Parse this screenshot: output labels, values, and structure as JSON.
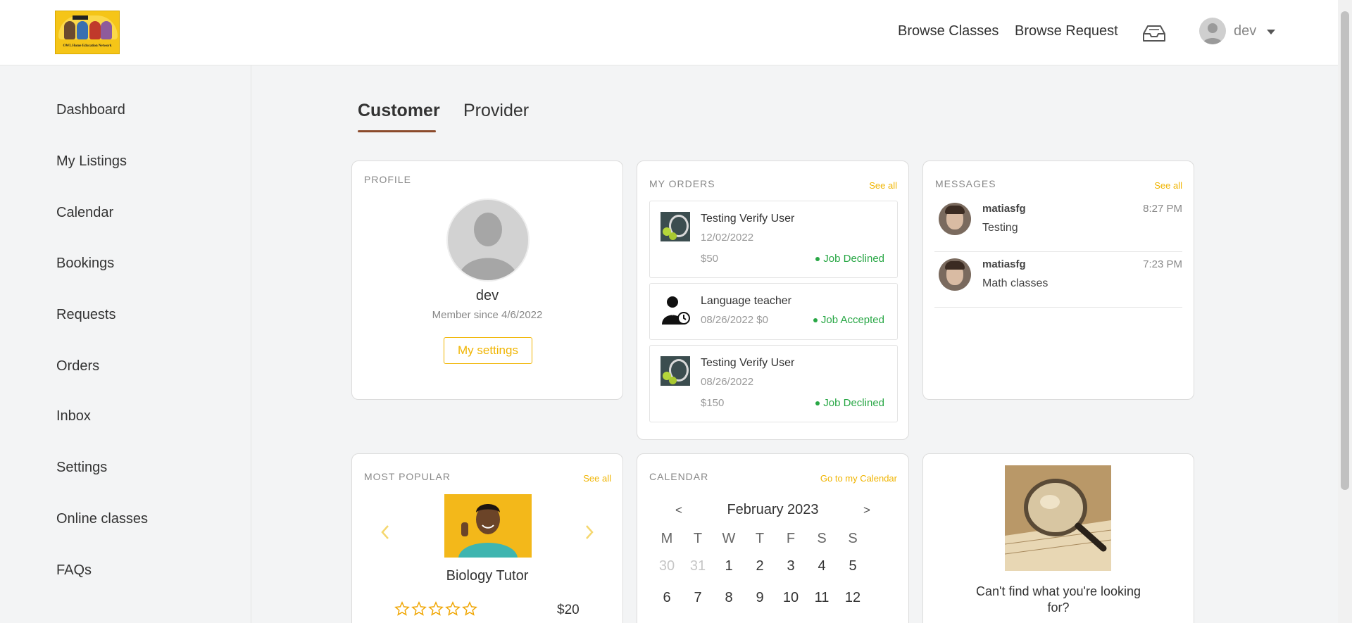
{
  "header": {
    "logo_text": "OWL Home Education Network",
    "nav": [
      "Browse Classes",
      "Browse Request"
    ],
    "user_name": "dev"
  },
  "sidebar": {
    "items": [
      "Dashboard",
      "My Listings",
      "Calendar",
      "Bookings",
      "Requests",
      "Orders",
      "Inbox",
      "Settings",
      "Online classes",
      "FAQs"
    ]
  },
  "tabs": [
    "Customer",
    "Provider"
  ],
  "profile": {
    "title": "PROFILE",
    "name": "dev",
    "member_since": "Member since 4/6/2022",
    "settings_label": "My settings"
  },
  "orders": {
    "title": "MY ORDERS",
    "see_all": "See all",
    "items": [
      {
        "title": "Testing Verify User",
        "date": "12/02/2022",
        "price": "$50",
        "status": "Job Declined"
      },
      {
        "title": "Language teacher",
        "date_price": "08/26/2022 $0",
        "status": "Job Accepted"
      },
      {
        "title": "Testing Verify User",
        "date": "08/26/2022",
        "price": "$150",
        "status": "Job Declined"
      }
    ]
  },
  "messages": {
    "title": "MESSAGES",
    "see_all": "See all",
    "items": [
      {
        "name": "matiasfg",
        "text": "Testing",
        "time": "8:27 PM"
      },
      {
        "name": "matiasfg",
        "text": "Math classes",
        "time": "7:23 PM"
      }
    ]
  },
  "popular": {
    "title": "MOST POPULAR",
    "see_all": "See all",
    "item_title": "Biology Tutor",
    "price": "$20",
    "rating": 0
  },
  "calendar": {
    "title": "CALENDAR",
    "goto": "Go to my Calendar",
    "month": "February 2023",
    "prev": "<",
    "next": ">",
    "weekdays": [
      "M",
      "T",
      "W",
      "T",
      "F",
      "S",
      "S"
    ],
    "rows": [
      [
        "30",
        "31",
        "1",
        "2",
        "3",
        "4",
        "5"
      ],
      [
        "6",
        "7",
        "8",
        "9",
        "10",
        "11",
        "12"
      ]
    ]
  },
  "find": {
    "text": "Can't find what you're looking for?"
  },
  "colors": {
    "accent": "#f0b400",
    "tab_underline": "#8b4a2b",
    "status_green": "#28a745"
  }
}
